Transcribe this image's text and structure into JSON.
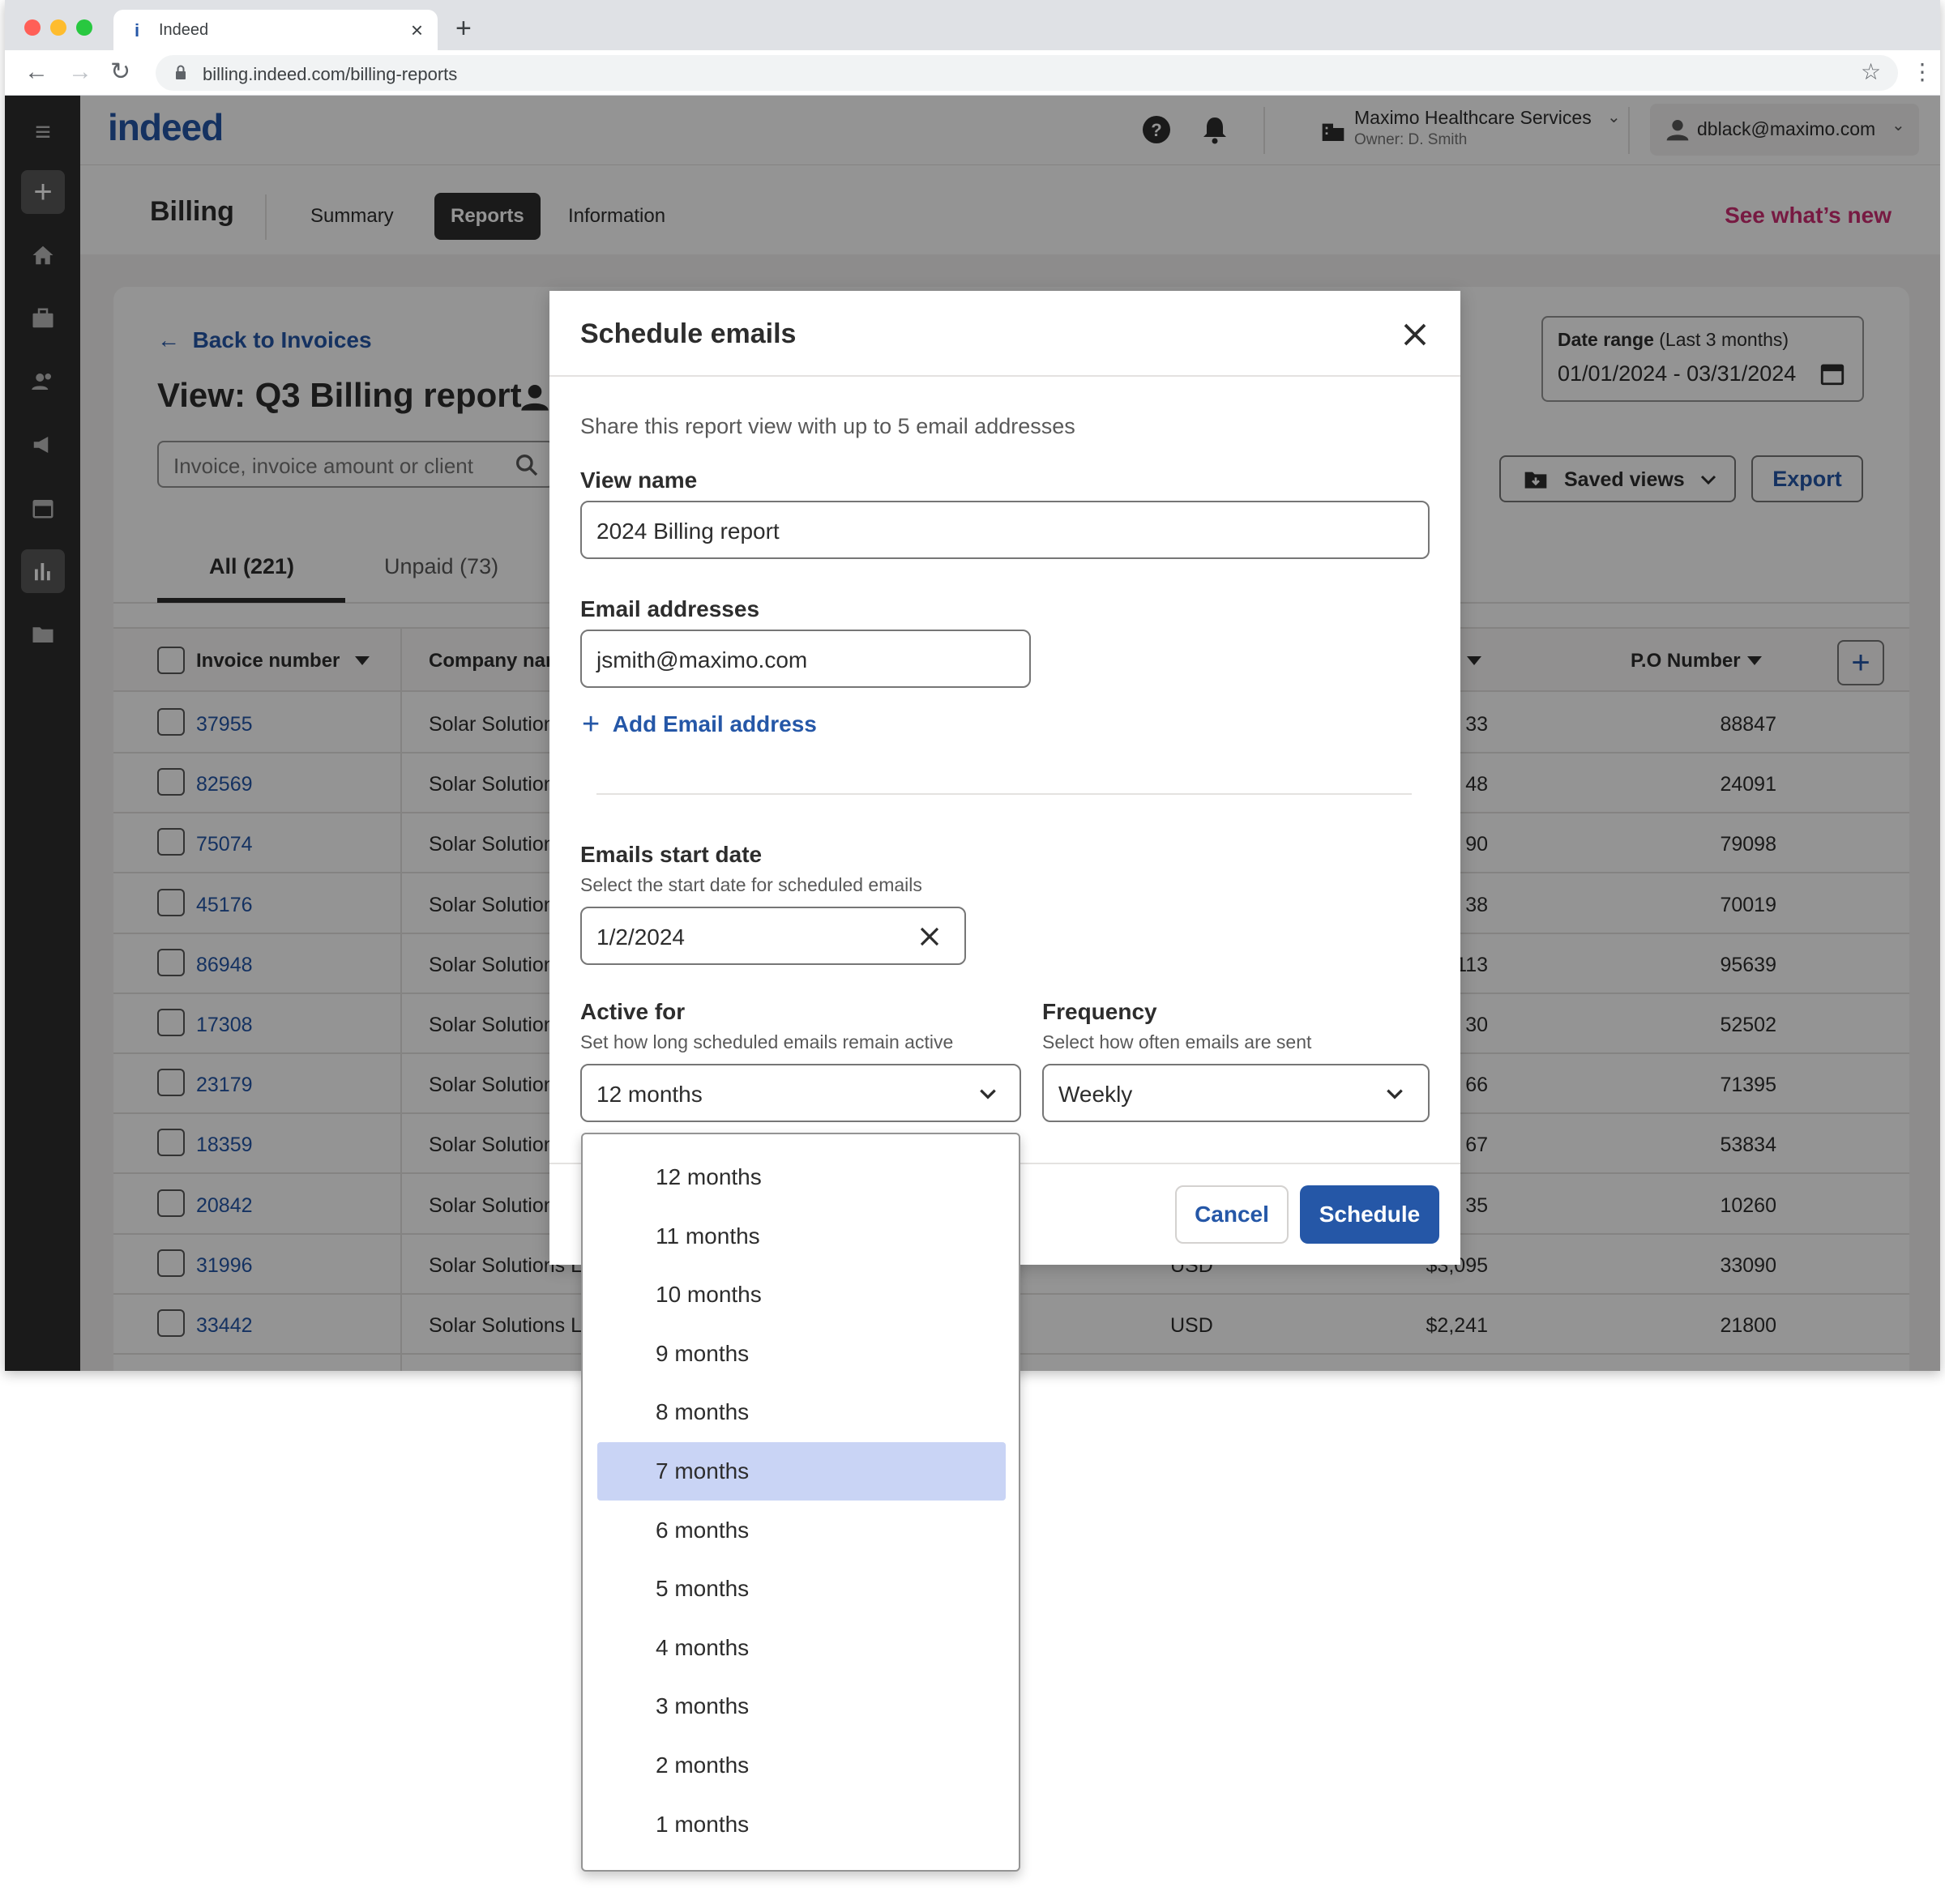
{
  "browser": {
    "tab_title": "Indeed",
    "url": "billing.indeed.com/billing-reports"
  },
  "header": {
    "logo": "indeed",
    "company_name": "Maximo Healthcare Services",
    "company_owner": "Owner: D. Smith",
    "user_email": "dblack@maximo.com"
  },
  "subnav": {
    "title": "Billing",
    "tabs": [
      "Summary",
      "Reports",
      "Information"
    ],
    "active_tab": "Reports",
    "see_new": "See what’s new"
  },
  "report": {
    "back_link": "Back to Invoices",
    "view_title": "View: Q3 Billing report",
    "search_placeholder": "Invoice, invoice amount or client",
    "tabs": [
      "All (221)",
      "Unpaid (73)"
    ],
    "date_range_label": "Date range",
    "date_range_hint": "(Last 3 months)",
    "date_range_value": "01/01/2024 - 03/31/2024",
    "saved_views": "Saved views",
    "export": "Export"
  },
  "table": {
    "columns": [
      "Invoice number",
      "Company nam",
      "P.O Number"
    ],
    "rows": [
      {
        "invoice": "37955",
        "company": "Solar Solutions",
        "currency": "",
        "amount": "33",
        "po": "88847"
      },
      {
        "invoice": "82569",
        "company": "Solar Solutions",
        "currency": "",
        "amount": "48",
        "po": "24091"
      },
      {
        "invoice": "75074",
        "company": "Solar Solutions",
        "currency": "",
        "amount": "90",
        "po": "79098"
      },
      {
        "invoice": "45176",
        "company": "Solar Solutions",
        "currency": "",
        "amount": "38",
        "po": "70019"
      },
      {
        "invoice": "86948",
        "company": "Solar Solutions",
        "currency": "",
        "amount": "113",
        "po": "95639"
      },
      {
        "invoice": "17308",
        "company": "Solar Solutions",
        "currency": "",
        "amount": "30",
        "po": "52502"
      },
      {
        "invoice": "23179",
        "company": "Solar Solutions",
        "currency": "",
        "amount": "66",
        "po": "71395"
      },
      {
        "invoice": "18359",
        "company": "Solar Solutions",
        "currency": "",
        "amount": "67",
        "po": "53834"
      },
      {
        "invoice": "20842",
        "company": "Solar Solutions",
        "currency": "",
        "amount": "35",
        "po": "10260"
      },
      {
        "invoice": "31996",
        "company": "Solar Solutions Lo",
        "currency": "USD",
        "amount": "$3,095",
        "po": "33090"
      },
      {
        "invoice": "33442",
        "company": "Solar Solutions Lo",
        "currency": "USD",
        "amount": "$2,241",
        "po": "21800"
      }
    ]
  },
  "modal": {
    "title": "Schedule emails",
    "intro": "Share this report view with up to 5 email addresses",
    "view_name_label": "View name",
    "view_name_value": "2024 Billing report",
    "email_label": "Email addresses",
    "email_value": "jsmith@maximo.com",
    "add_email": "Add Email address",
    "start_label": "Emails start date",
    "start_help": "Select the start date for scheduled emails",
    "start_value": "1/2/2024",
    "active_label": "Active for",
    "active_help": "Set how long scheduled emails remain active",
    "active_value": "12 months",
    "freq_label": "Frequency",
    "freq_help": "Select how often emails are sent",
    "freq_value": "Weekly",
    "cancel": "Cancel",
    "schedule": "Schedule"
  },
  "dropdown": {
    "options": [
      "12 months",
      "11 months",
      "10 months",
      "9 months",
      "8 months",
      "7 months",
      "6 months",
      "5 months",
      "4 months",
      "3 months",
      "2 months",
      "1 months"
    ],
    "highlighted": "7 months"
  },
  "colors": {
    "brand_blue": "#2557a7",
    "highlight": "#c9d4f5",
    "see_new_pink": "#cd2d72"
  }
}
